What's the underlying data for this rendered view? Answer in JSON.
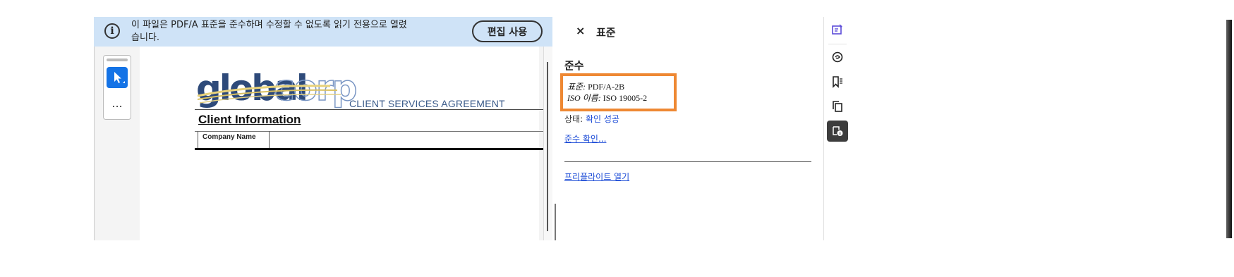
{
  "banner": {
    "message": "이 파일은 PDF/A 표준을 준수하며 수정할 수 없도록 읽기 전용으로 열렸습니다.",
    "edit_button": "편집 사용",
    "icon": "info-icon"
  },
  "tools": {
    "select_icon": "cursor-icon",
    "more_label": "..."
  },
  "document": {
    "logo_text": "globalcorp",
    "agreement_title": "CLIENT SERVICES AGREEMENT",
    "section_heading": "Client Information",
    "company_name_label": "Company Name"
  },
  "panel": {
    "close_label": "×",
    "title": "표준",
    "section": "준수",
    "standard_label": "표준:",
    "standard_value": "PDF/A-2B",
    "iso_label": "ISO 이름:",
    "iso_value": "ISO 19005-2",
    "status_label": "상태:",
    "status_value": "확인 성공",
    "check_link": "준수 확인...",
    "preflight_link": "프리플라이트 열기"
  },
  "rail": {
    "icons": [
      "edit-pdf-icon",
      "comment-icon",
      "bookmark-icon",
      "pages-icon",
      "standards-icon"
    ]
  },
  "colors": {
    "banner_bg": "#cfe3f7",
    "accent_blue": "#1473e6",
    "highlight_box": "#ee8833",
    "link": "#1a4ad6"
  }
}
